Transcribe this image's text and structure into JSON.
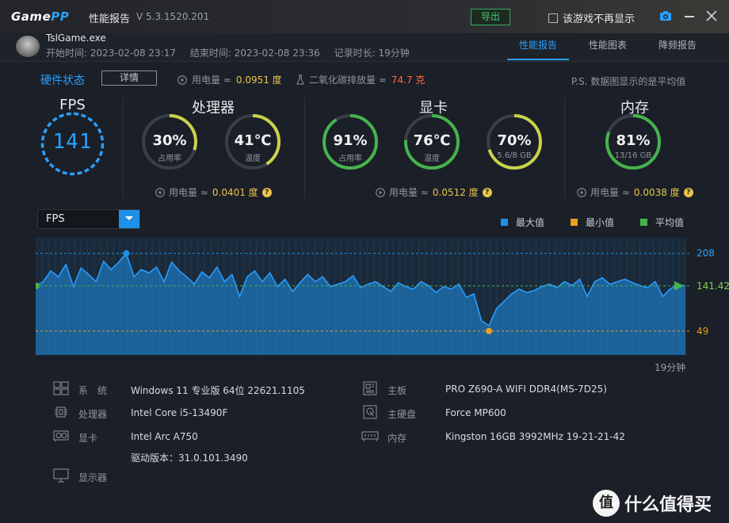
{
  "titlebar": {
    "logo_a": "Game",
    "logo_b": "PP",
    "title": "性能报告",
    "version": "V 5.3.1520.201",
    "export": "导出",
    "no_show": "该游戏不再显示"
  },
  "session": {
    "exe": "TslGame.exe",
    "start": "开始时间: 2023-02-08 23:17",
    "end": "结束时间: 2023-02-08 23:36",
    "duration": "记录时长: 19分钟"
  },
  "tabs": [
    "性能报告",
    "性能图表",
    "降频报告"
  ],
  "status": {
    "title": "硬件状态",
    "details": "详情",
    "power_label": "用电量 ≈",
    "power_value": "0.0951 度",
    "co2_label": "二氧化碳排放量 ≈",
    "co2_value": "74.7 克",
    "note": "P.S. 数据图显示的是平均值"
  },
  "sections": {
    "fps": "FPS",
    "cpu": "处理器",
    "gpu": "显卡",
    "mem": "内存"
  },
  "fps_value": "141",
  "gauges": [
    {
      "id": "cpu-usage",
      "value": "30%",
      "sub": "占用率",
      "level": 0.3,
      "color": "#c9d34a"
    },
    {
      "id": "cpu-temp",
      "value": "41℃",
      "sub": "温度",
      "level": 0.41,
      "color": "#c9d34a"
    },
    {
      "id": "gpu-usage",
      "value": "91%",
      "sub": "占用率",
      "level": 0.91,
      "color": "#46b34c"
    },
    {
      "id": "gpu-temp",
      "value": "76℃",
      "sub": "温度",
      "level": 0.76,
      "color": "#46b34c"
    },
    {
      "id": "gpu-mem",
      "value": "70%",
      "sub": "5.6/8 GB",
      "level": 0.7,
      "color": "#c9d34a"
    },
    {
      "id": "mem-usage",
      "value": "81%",
      "sub": "13/16 GB",
      "level": 0.81,
      "color": "#46b34c"
    }
  ],
  "power": {
    "label": "用电量 ≈",
    "cpu": "0.0401 度",
    "gpu": "0.0512 度",
    "mem": "0.0038 度"
  },
  "chart": {
    "metric": "FPS",
    "legend": [
      {
        "label": "最大值",
        "color": "#1f8fe8"
      },
      {
        "label": "最小值",
        "color": "#e8a020"
      },
      {
        "label": "平均值",
        "color": "#46b34c"
      }
    ],
    "max_label": "208",
    "avg_label": "141.42",
    "min_label": "49",
    "time_label": "19分钟"
  },
  "chart_data": {
    "type": "area",
    "title": "",
    "xlabel": "",
    "ylabel": "FPS",
    "x_range_minutes": [
      0,
      19
    ],
    "ylim": [
      0,
      240
    ],
    "reference_lines": {
      "max": 208,
      "avg": 141.42,
      "min": 49
    },
    "series": [
      {
        "name": "FPS",
        "values": [
          141,
          150,
          172,
          160,
          185,
          140,
          178,
          165,
          150,
          192,
          175,
          190,
          208,
          160,
          175,
          168,
          180,
          150,
          190,
          172,
          160,
          145,
          170,
          158,
          180,
          150,
          165,
          120,
          160,
          172,
          150,
          168,
          140,
          155,
          130,
          148,
          165,
          150,
          160,
          140,
          145,
          150,
          162,
          138,
          145,
          150,
          140,
          130,
          148,
          140,
          135,
          150,
          142,
          128,
          140,
          135,
          145,
          118,
          125,
          70,
          60,
          95,
          110,
          125,
          135,
          128,
          132,
          140,
          145,
          138,
          150,
          142,
          155,
          120,
          150,
          158,
          145,
          150,
          155,
          148,
          142,
          138,
          150,
          120,
          135,
          145,
          141
        ]
      }
    ]
  },
  "system": {
    "os_label": "系　统",
    "os_value": "Windows 11 专业版 64位 22621.1105",
    "cpu_label": "处理器",
    "cpu_value": "Intel Core i5-13490F",
    "gpu_label": "显卡",
    "gpu_value": "Intel Arc A750",
    "driver": "驱动版本：31.0.101.3490",
    "display_label": "显示器",
    "board_label": "主板",
    "board_value": "PRO Z690-A WIFI DDR4(MS-7D25)",
    "disk_label": "主硬盘",
    "disk_value": "Force MP600",
    "ram_label": "内存",
    "ram_value": "Kingston 16GB 3992MHz 19-21-21-42"
  },
  "watermark": {
    "mark": "值",
    "text": "什么值得买"
  }
}
